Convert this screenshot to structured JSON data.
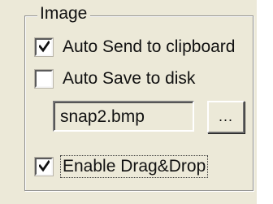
{
  "group": {
    "title": "Image"
  },
  "options": {
    "auto_send": {
      "label": "Auto Send to clipboard",
      "checked": true
    },
    "auto_save": {
      "label": "Auto Save to disk",
      "checked": false
    },
    "drag_drop": {
      "label": "Enable Drag&Drop",
      "checked": true
    }
  },
  "file": {
    "value": "snap2.bmp",
    "browse_label": "..."
  },
  "icons": {
    "checkmark": "checkmark-icon"
  }
}
